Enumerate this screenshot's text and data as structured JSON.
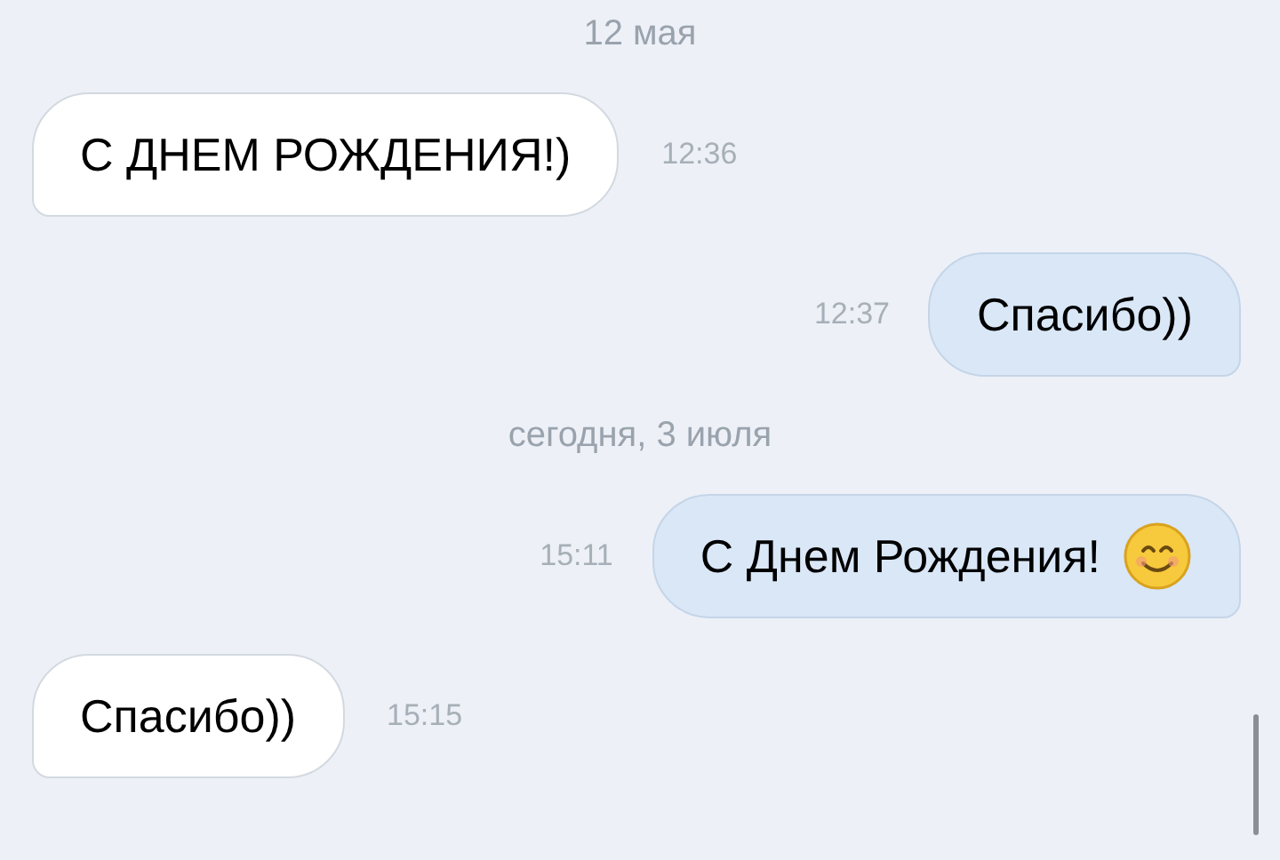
{
  "messages": [
    {
      "kind": "date",
      "text": "12 мая"
    },
    {
      "kind": "incoming",
      "text": "С ДНЕМ РОЖДЕНИЯ!)",
      "time": "12:36",
      "emoji": false
    },
    {
      "kind": "outgoing",
      "text": "Спасибо))",
      "time": "12:37",
      "emoji": false
    },
    {
      "kind": "date",
      "text": "сегодня, 3 июля"
    },
    {
      "kind": "outgoing",
      "text": "С Днем Рождения!",
      "time": "15:11",
      "emoji": true
    },
    {
      "kind": "incoming",
      "text": "Спасибо))",
      "time": "15:15",
      "emoji": false
    }
  ]
}
